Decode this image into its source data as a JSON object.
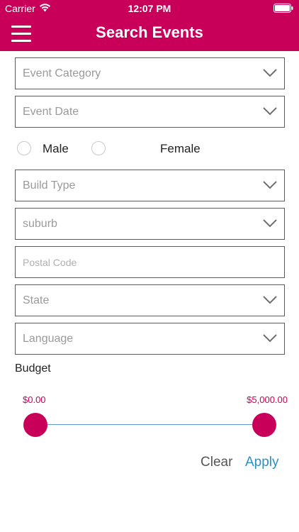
{
  "status_bar": {
    "carrier": "Carrier",
    "time": "12:07 PM"
  },
  "header": {
    "title": "Search Events",
    "menu_icon": "hamburger-menu-icon",
    "background": "#c8005a"
  },
  "form": {
    "event_category": {
      "placeholder": "Event Category"
    },
    "event_date": {
      "placeholder": "Event Date"
    },
    "gender": {
      "options": [
        "Male",
        "Female"
      ]
    },
    "build_type": {
      "placeholder": "Build Type"
    },
    "suburb": {
      "placeholder": "suburb"
    },
    "postal_code": {
      "placeholder": "Postal Code"
    },
    "state": {
      "placeholder": "State"
    },
    "language": {
      "placeholder": "Language"
    }
  },
  "budget": {
    "label": "Budget",
    "min_label": "$0.00",
    "max_label": "$5,000.00",
    "min_value": 0,
    "max_value": 5000,
    "accent": "#c8005a",
    "track_color": "#5b9bcf"
  },
  "actions": {
    "clear_label": "Clear",
    "apply_label": "Apply",
    "apply_color": "#2c8fc4"
  }
}
